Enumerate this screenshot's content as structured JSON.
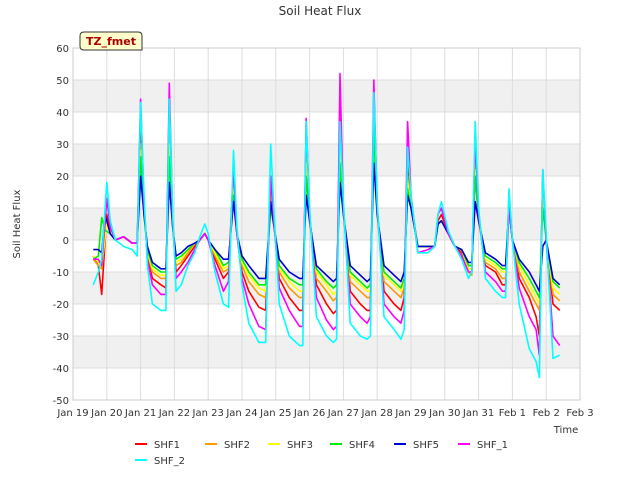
{
  "chart_data": {
    "type": "line",
    "title": "Soil Heat Flux",
    "xlabel": "Time",
    "ylabel": "Soil Heat Flux",
    "annotation": "TZ_fmet",
    "ylim": [
      -50,
      60
    ],
    "yticks": [
      -50,
      -40,
      -30,
      -20,
      -10,
      0,
      10,
      20,
      30,
      40,
      50,
      60
    ],
    "xlim": [
      0,
      15
    ],
    "xticks": [
      {
        "pos": 0,
        "label": "Jan 19"
      },
      {
        "pos": 1,
        "label": "Jan 20"
      },
      {
        "pos": 2,
        "label": "Jan 21"
      },
      {
        "pos": 3,
        "label": "Jan 22"
      },
      {
        "pos": 4,
        "label": "Jan 23"
      },
      {
        "pos": 5,
        "label": "Jan 24"
      },
      {
        "pos": 6,
        "label": "Jan 25"
      },
      {
        "pos": 7,
        "label": "Jan 26"
      },
      {
        "pos": 8,
        "label": "Jan 27"
      },
      {
        "pos": 9,
        "label": "Jan 28"
      },
      {
        "pos": 10,
        "label": "Jan 29"
      },
      {
        "pos": 11,
        "label": "Jan 30"
      },
      {
        "pos": 12,
        "label": "Jan 31"
      },
      {
        "pos": 13,
        "label": "Feb 1"
      },
      {
        "pos": 14,
        "label": "Feb 2"
      },
      {
        "pos": 15,
        "label": "Feb 3"
      }
    ],
    "grid": true,
    "banded_background": true,
    "legend_position": "bottom",
    "series": [
      {
        "name": "SHF1",
        "color": "#ff0000",
        "x": [
          0.6,
          0.75,
          0.85,
          1.0,
          1.1,
          1.25,
          1.5,
          1.75,
          1.9,
          2.0,
          2.1,
          2.2,
          2.35,
          2.6,
          2.75,
          2.85,
          2.95,
          3.05,
          3.2,
          3.4,
          3.6,
          3.75,
          3.9,
          4.0,
          4.2,
          4.45,
          4.6,
          4.75,
          4.85,
          5.0,
          5.2,
          5.5,
          5.7,
          5.85,
          5.95,
          6.1,
          6.4,
          6.7,
          6.8,
          6.9,
          7.0,
          7.2,
          7.5,
          7.7,
          7.8,
          7.9,
          8.0,
          8.2,
          8.5,
          8.7,
          8.8,
          8.9,
          9.0,
          9.2,
          9.5,
          9.7,
          9.8,
          9.9,
          10.0,
          10.2,
          10.5,
          10.7,
          10.8,
          10.9,
          11.1,
          11.3,
          11.5,
          11.7,
          11.8,
          11.9,
          12.0,
          12.2,
          12.5,
          12.7,
          12.8,
          12.9,
          13.0,
          13.2,
          13.5,
          13.7,
          13.8,
          13.9,
          14.0,
          14.2,
          14.4
        ],
        "y": [
          -5,
          -8,
          -17,
          8,
          2,
          0,
          1,
          -1,
          -1,
          38,
          10,
          -5,
          -12,
          -14,
          -15,
          38,
          5,
          -10,
          -8,
          -5,
          -2,
          0,
          2,
          0,
          -6,
          -12,
          -10,
          22,
          2,
          -10,
          -16,
          -21,
          -22,
          18,
          5,
          -12,
          -18,
          -22,
          -22,
          32,
          8,
          -14,
          -20,
          -23,
          -22,
          38,
          10,
          -16,
          -20,
          -22,
          -22,
          40,
          10,
          -16,
          -20,
          -22,
          -18,
          24,
          12,
          -2,
          -2,
          -2,
          6,
          8,
          2,
          -2,
          -4,
          -8,
          -8,
          28,
          8,
          -8,
          -10,
          -14,
          -14,
          14,
          0,
          -12,
          -18,
          -24,
          -30,
          20,
          0,
          -20,
          -22
        ]
      },
      {
        "name": "SHF2",
        "color": "#ff9900",
        "x": [
          0.6,
          0.75,
          0.85,
          1.0,
          1.1,
          1.25,
          1.5,
          1.75,
          1.9,
          2.0,
          2.1,
          2.2,
          2.35,
          2.6,
          2.75,
          2.85,
          2.95,
          3.05,
          3.2,
          3.4,
          3.6,
          3.75,
          3.9,
          4.0,
          4.2,
          4.45,
          4.6,
          4.75,
          4.85,
          5.0,
          5.2,
          5.5,
          5.7,
          5.85,
          5.95,
          6.1,
          6.4,
          6.7,
          6.8,
          6.9,
          7.0,
          7.2,
          7.5,
          7.7,
          7.8,
          7.9,
          8.0,
          8.2,
          8.5,
          8.7,
          8.8,
          8.9,
          9.0,
          9.2,
          9.5,
          9.7,
          9.8,
          9.9,
          10.0,
          10.2,
          10.5,
          10.7,
          10.8,
          10.9,
          11.1,
          11.3,
          11.5,
          11.7,
          11.8,
          11.9,
          12.0,
          12.2,
          12.5,
          12.7,
          12.8,
          12.9,
          13.0,
          13.2,
          13.5,
          13.7,
          13.8,
          13.9,
          14.0,
          14.2,
          14.4
        ],
        "y": [
          -6,
          -8,
          -9,
          6,
          2,
          0,
          1,
          -1,
          -1,
          30,
          8,
          -4,
          -10,
          -12,
          -12,
          32,
          4,
          -8,
          -7,
          -4,
          -1,
          0,
          2,
          0,
          -5,
          -10,
          -9,
          18,
          2,
          -8,
          -13,
          -17,
          -18,
          14,
          4,
          -10,
          -15,
          -18,
          -18,
          26,
          6,
          -12,
          -16,
          -19,
          -18,
          30,
          8,
          -13,
          -16,
          -18,
          -18,
          32,
          8,
          -13,
          -16,
          -18,
          -15,
          20,
          10,
          -2,
          -2,
          -2,
          5,
          6,
          2,
          -2,
          -3,
          -10,
          -11,
          24,
          6,
          -7,
          -9,
          -12,
          -12,
          12,
          0,
          -10,
          -16,
          -20,
          -22,
          16,
          0,
          -17,
          -19
        ]
      },
      {
        "name": "SHF3",
        "color": "#ffff00",
        "x": [
          0.6,
          0.75,
          0.85,
          1.0,
          1.1,
          1.25,
          1.5,
          1.75,
          1.9,
          2.0,
          2.1,
          2.2,
          2.35,
          2.6,
          2.75,
          2.85,
          2.95,
          3.05,
          3.2,
          3.4,
          3.6,
          3.75,
          3.9,
          4.0,
          4.2,
          4.45,
          4.6,
          4.75,
          4.85,
          5.0,
          5.2,
          5.5,
          5.7,
          5.85,
          5.95,
          6.1,
          6.4,
          6.7,
          6.8,
          6.9,
          7.0,
          7.2,
          7.5,
          7.7,
          7.8,
          7.9,
          8.0,
          8.2,
          8.5,
          8.7,
          8.8,
          8.9,
          9.0,
          9.2,
          9.5,
          9.7,
          9.8,
          9.9,
          10.0,
          10.2,
          10.5,
          10.7,
          10.8,
          10.9,
          11.1,
          11.3,
          11.5,
          11.7,
          11.8,
          11.9,
          12.0,
          12.2,
          12.5,
          12.7,
          12.8,
          12.9,
          13.0,
          13.2,
          13.5,
          13.7,
          13.8,
          13.9,
          14.0,
          14.2,
          14.4
        ],
        "y": [
          -5,
          -7,
          -8,
          5,
          2,
          0,
          1,
          -1,
          -1,
          28,
          8,
          -4,
          -9,
          -11,
          -11,
          30,
          4,
          -7,
          -6,
          -3,
          -1,
          0,
          2,
          0,
          -4,
          -9,
          -8,
          16,
          2,
          -7,
          -11,
          -15,
          -16,
          12,
          4,
          -9,
          -13,
          -16,
          -16,
          24,
          6,
          -10,
          -14,
          -17,
          -16,
          28,
          8,
          -11,
          -14,
          -16,
          -16,
          30,
          8,
          -11,
          -14,
          -16,
          -13,
          18,
          10,
          -2,
          -2,
          -2,
          5,
          6,
          2,
          -2,
          -3,
          -9,
          -9,
          22,
          6,
          -6,
          -8,
          -10,
          -10,
          10,
          0,
          -8,
          -14,
          -18,
          -20,
          14,
          0,
          -15,
          -17
        ]
      },
      {
        "name": "SHF4",
        "color": "#00ee00",
        "x": [
          0.6,
          0.75,
          0.85,
          0.95,
          1.1,
          1.25,
          1.5,
          1.75,
          1.9,
          2.0,
          2.1,
          2.2,
          2.35,
          2.6,
          2.75,
          2.85,
          2.95,
          3.05,
          3.2,
          3.4,
          3.6,
          3.75,
          3.9,
          4.0,
          4.2,
          4.45,
          4.6,
          4.75,
          4.85,
          5.0,
          5.2,
          5.5,
          5.7,
          5.85,
          5.95,
          6.1,
          6.4,
          6.7,
          6.8,
          6.9,
          7.0,
          7.2,
          7.5,
          7.7,
          7.8,
          7.9,
          8.0,
          8.2,
          8.5,
          8.7,
          8.8,
          8.9,
          9.0,
          9.2,
          9.5,
          9.7,
          9.8,
          9.9,
          10.0,
          10.2,
          10.5,
          10.7,
          10.8,
          10.9,
          11.1,
          11.3,
          11.5,
          11.7,
          11.8,
          11.9,
          12.0,
          12.2,
          12.5,
          12.7,
          12.8,
          12.9,
          13.0,
          13.2,
          13.5,
          13.7,
          13.8,
          13.9,
          14.0,
          14.2,
          14.4
        ],
        "y": [
          -6,
          -5,
          7,
          3,
          2,
          0,
          1,
          -1,
          -1,
          26,
          8,
          -3,
          -8,
          -10,
          -10,
          26,
          4,
          -6,
          -5,
          -3,
          -1,
          0,
          2,
          0,
          -3,
          -8,
          -7,
          14,
          2,
          -6,
          -10,
          -14,
          -14,
          10,
          4,
          -8,
          -12,
          -14,
          -14,
          20,
          6,
          -9,
          -13,
          -15,
          -14,
          24,
          8,
          -10,
          -13,
          -15,
          -14,
          34,
          8,
          -10,
          -13,
          -15,
          -12,
          16,
          10,
          -2,
          -2,
          -2,
          5,
          6,
          2,
          -2,
          -3,
          -8,
          -8,
          20,
          6,
          -5,
          -7,
          -9,
          -9,
          10,
          0,
          -7,
          -12,
          -16,
          -18,
          10,
          0,
          -13,
          -15
        ]
      },
      {
        "name": "SHF5",
        "color": "#0000cc",
        "x": [
          0.6,
          0.75,
          0.85,
          0.95,
          1.1,
          1.25,
          1.5,
          1.75,
          1.9,
          2.0,
          2.1,
          2.2,
          2.35,
          2.6,
          2.75,
          2.85,
          2.95,
          3.05,
          3.2,
          3.4,
          3.6,
          3.75,
          3.9,
          4.0,
          4.2,
          4.45,
          4.6,
          4.75,
          4.85,
          5.0,
          5.2,
          5.5,
          5.7,
          5.85,
          5.95,
          6.1,
          6.4,
          6.7,
          6.8,
          6.9,
          7.0,
          7.2,
          7.5,
          7.7,
          7.8,
          7.9,
          8.0,
          8.2,
          8.5,
          8.7,
          8.8,
          8.9,
          9.0,
          9.2,
          9.5,
          9.7,
          9.8,
          9.9,
          10.0,
          10.2,
          10.5,
          10.7,
          10.8,
          10.9,
          11.1,
          11.3,
          11.5,
          11.7,
          11.8,
          11.9,
          12.0,
          12.2,
          12.5,
          12.7,
          12.8,
          12.9,
          13.0,
          13.2,
          13.5,
          13.7,
          13.8,
          13.9,
          14.0,
          14.2,
          14.4
        ],
        "y": [
          -3,
          -3,
          -4,
          8,
          2,
          0,
          1,
          -1,
          -1,
          20,
          8,
          -2,
          -7,
          -9,
          -9,
          18,
          4,
          -5,
          -4,
          -2,
          -1,
          0,
          2,
          0,
          -3,
          -6,
          -6,
          12,
          2,
          -5,
          -8,
          -12,
          -12,
          12,
          4,
          -6,
          -10,
          -12,
          -12,
          14,
          6,
          -8,
          -11,
          -13,
          -12,
          18,
          8,
          -8,
          -11,
          -13,
          -12,
          24,
          8,
          -8,
          -11,
          -13,
          -10,
          14,
          10,
          -2,
          -2,
          -2,
          5,
          6,
          2,
          -2,
          -3,
          -7,
          -7,
          12,
          6,
          -4,
          -6,
          -8,
          -8,
          10,
          0,
          -6,
          -10,
          -14,
          -16,
          -2,
          0,
          -12,
          -14
        ]
      },
      {
        "name": "SHF_1",
        "color": "#ff00ff",
        "x": [
          0.6,
          0.75,
          0.85,
          1.0,
          1.1,
          1.25,
          1.5,
          1.75,
          1.9,
          2.0,
          2.1,
          2.2,
          2.35,
          2.6,
          2.75,
          2.85,
          2.95,
          3.05,
          3.2,
          3.4,
          3.6,
          3.75,
          3.9,
          4.0,
          4.2,
          4.45,
          4.6,
          4.75,
          4.85,
          5.0,
          5.2,
          5.5,
          5.7,
          5.85,
          5.95,
          6.1,
          6.4,
          6.7,
          6.8,
          6.9,
          7.0,
          7.2,
          7.5,
          7.7,
          7.8,
          7.9,
          8.0,
          8.2,
          8.5,
          8.7,
          8.8,
          8.9,
          9.0,
          9.2,
          9.5,
          9.7,
          9.8,
          9.9,
          10.0,
          10.2,
          10.5,
          10.7,
          10.8,
          10.9,
          11.1,
          11.3,
          11.5,
          11.7,
          11.8,
          11.9,
          12.0,
          12.2,
          12.5,
          12.7,
          12.8,
          12.9,
          13.0,
          13.2,
          13.5,
          13.7,
          13.8,
          13.9,
          14.0,
          14.2,
          14.4
        ],
        "y": [
          -6,
          -6,
          -8,
          13,
          4,
          0,
          1,
          -1,
          -1,
          44,
          12,
          -6,
          -14,
          -17,
          -17,
          49,
          6,
          -12,
          -10,
          -7,
          -3,
          0,
          2,
          0,
          -8,
          -16,
          -13,
          23,
          2,
          -12,
          -20,
          -27,
          -28,
          20,
          5,
          -15,
          -22,
          -27,
          -27,
          38,
          8,
          -18,
          -25,
          -28,
          -27,
          52,
          10,
          -20,
          -24,
          -26,
          -24,
          50,
          10,
          -20,
          -24,
          -26,
          -22,
          37,
          14,
          -4,
          -3,
          -2,
          8,
          10,
          2,
          -2,
          -5,
          -10,
          -10,
          32,
          8,
          -10,
          -13,
          -16,
          -16,
          10,
          0,
          -15,
          -24,
          -28,
          -36,
          22,
          0,
          -30,
          -33
        ]
      },
      {
        "name": "SHF_2",
        "color": "#00ffff",
        "x": [
          0.6,
          0.75,
          0.85,
          1.0,
          1.1,
          1.25,
          1.5,
          1.75,
          1.9,
          2.0,
          2.1,
          2.2,
          2.35,
          2.6,
          2.75,
          2.85,
          2.95,
          3.05,
          3.2,
          3.4,
          3.6,
          3.75,
          3.9,
          4.0,
          4.2,
          4.45,
          4.6,
          4.75,
          4.85,
          5.0,
          5.2,
          5.5,
          5.7,
          5.85,
          5.95,
          6.1,
          6.4,
          6.7,
          6.8,
          6.9,
          7.0,
          7.2,
          7.5,
          7.7,
          7.8,
          7.9,
          8.0,
          8.2,
          8.5,
          8.7,
          8.8,
          8.9,
          9.0,
          9.2,
          9.5,
          9.7,
          9.8,
          9.9,
          10.0,
          10.2,
          10.5,
          10.7,
          10.8,
          10.9,
          11.1,
          11.3,
          11.5,
          11.7,
          11.8,
          11.9,
          12.0,
          12.2,
          12.5,
          12.7,
          12.8,
          12.9,
          13.0,
          13.2,
          13.5,
          13.7,
          13.8,
          13.9,
          14.0,
          14.2,
          14.4
        ],
        "y": [
          -14,
          -10,
          -6,
          18,
          6,
          0,
          -2,
          -3,
          -5,
          43,
          14,
          -8,
          -20,
          -22,
          -22,
          44,
          8,
          -16,
          -14,
          -8,
          -4,
          1,
          5,
          2,
          -10,
          -20,
          -21,
          28,
          4,
          -14,
          -26,
          -32,
          -32,
          30,
          8,
          -20,
          -30,
          -33,
          -33,
          37,
          10,
          -24,
          -30,
          -32,
          -31,
          37,
          12,
          -26,
          -30,
          -31,
          -30,
          46,
          12,
          -24,
          -28,
          -31,
          -28,
          29,
          14,
          -4,
          -4,
          -2,
          8,
          12,
          3,
          -2,
          -6,
          -12,
          -10,
          37,
          10,
          -12,
          -16,
          -18,
          -18,
          16,
          0,
          -20,
          -34,
          -38,
          -43,
          22,
          2,
          -37,
          -36
        ]
      }
    ]
  }
}
